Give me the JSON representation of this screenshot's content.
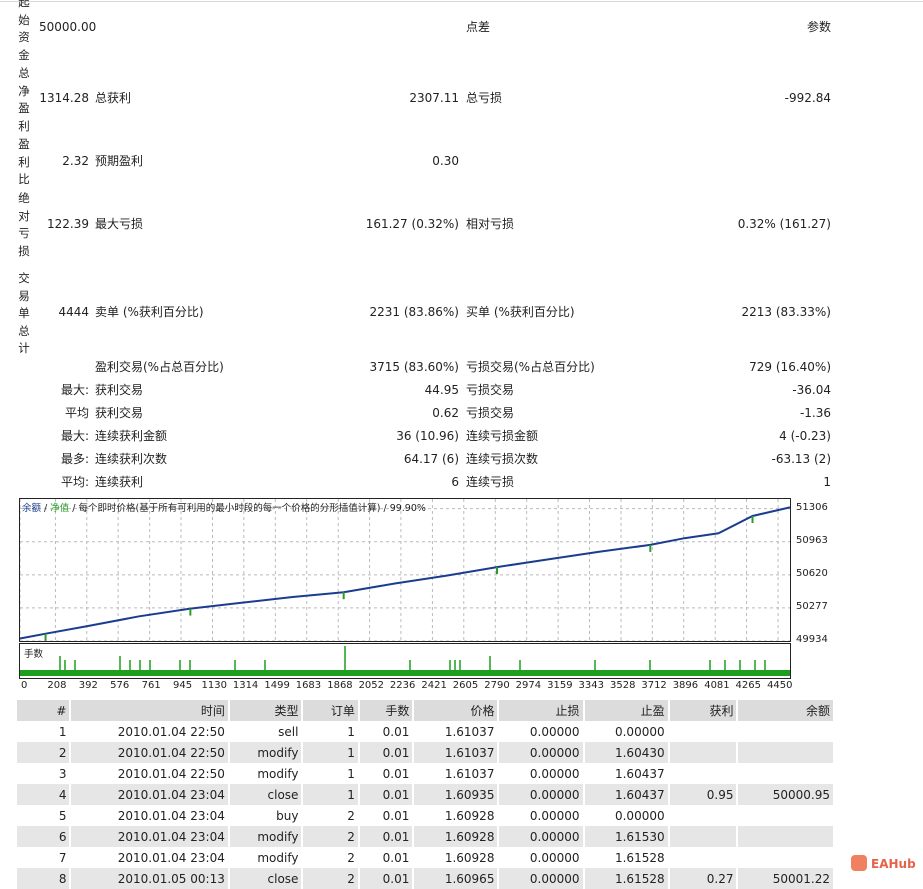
{
  "summary": {
    "initial_deposit_label": "起始资金",
    "initial_deposit": "50000.00",
    "spread_label": "点差",
    "params_label": "参数",
    "net_profit_label": "总净盈利",
    "net_profit": "1314.28",
    "gross_profit_label": "总获利",
    "gross_profit": "2307.11",
    "gross_loss_label": "总亏损",
    "gross_loss": "-992.84",
    "profit_factor_label": "盈利比",
    "profit_factor": "2.32",
    "expected_payoff_label": "预期盈利",
    "expected_payoff": "0.30",
    "abs_drawdown_label": "绝对亏损",
    "abs_drawdown": "122.39",
    "max_drawdown_label": "最大亏损",
    "max_drawdown": "161.27 (0.32%)",
    "rel_drawdown_label": "相对亏损",
    "rel_drawdown": "0.32% (161.27)",
    "total_trades_label": "交易单总计",
    "total_trades": "4444",
    "short_label": "卖单 (%获利百分比)",
    "short_value": "2231 (83.86%)",
    "long_label": "买单 (%获利百分比)",
    "long_value": "2213 (83.33%)",
    "profit_trades_label": "盈利交易(%占总百分比)",
    "profit_trades": "3715 (83.60%)",
    "loss_trades_label": "亏损交易(%占总百分比)",
    "loss_trades": "729 (16.40%)",
    "largest_prefix": "最大:",
    "largest_profit_label": "获利交易",
    "largest_profit": "44.95",
    "largest_loss_label": "亏损交易",
    "largest_loss": "-36.04",
    "average_prefix": "平均",
    "average_profit_label": "获利交易",
    "average_profit": "0.62",
    "average_loss_label": "亏损交易",
    "average_loss": "-1.36",
    "max_prefix": "最大:",
    "max_consec_win_money_label": "连续获利金额",
    "max_consec_win_money": "36 (10.96)",
    "max_consec_loss_money_label": "连续亏损金额",
    "max_consec_loss_money": "4 (-0.23)",
    "most_prefix": "最多:",
    "most_consec_win_count_label": "连续获利次数",
    "most_consec_win_count": "64.17 (6)",
    "most_consec_loss_count_label": "连续亏损次数",
    "most_consec_loss_count": "-63.13 (2)",
    "avg_prefix": "平均:",
    "avg_consec_win_label": "连续获利",
    "avg_consec_win": "6",
    "avg_consec_loss_label": "连续亏损",
    "avg_consec_loss": "1"
  },
  "chart_data": {
    "type": "line",
    "legend_balance": "余额",
    "legend_equity": "净值",
    "legend_text": "每个即时价格(基于所有可利用的最小时段的每一个价格的分形插值计算)",
    "legend_quality": "99.90%",
    "volume_label": "手数",
    "yticks": [
      "51306",
      "50963",
      "50620",
      "50277",
      "49934"
    ],
    "xticks": [
      "0",
      "208",
      "392",
      "576",
      "761",
      "945",
      "1130",
      "1314",
      "1499",
      "1683",
      "1868",
      "2052",
      "2236",
      "2421",
      "2605",
      "2790",
      "2974",
      "3159",
      "3343",
      "3528",
      "3712",
      "3896",
      "4081",
      "4265",
      "4450"
    ],
    "ylim": [
      49934,
      51406
    ],
    "xlim": [
      0,
      4520
    ],
    "series": [
      {
        "name": "余额",
        "x": [
          0,
          150,
          400,
          700,
          1000,
          1300,
          1600,
          1900,
          2200,
          2500,
          2800,
          3100,
          3400,
          3700,
          3900,
          4100,
          4300,
          4520
        ],
        "values": [
          49960,
          50010,
          50090,
          50190,
          50270,
          50330,
          50390,
          50440,
          50530,
          50610,
          50700,
          50780,
          50860,
          50930,
          51000,
          51050,
          51230,
          51320
        ]
      }
    ],
    "colors": {
      "balance": "#1a3d8f",
      "equity": "#2a9a2a",
      "volume": "#1e9e1e"
    }
  },
  "table": {
    "headers": [
      "#",
      "时间",
      "类型",
      "订单",
      "手数",
      "价格",
      "止损",
      "止盈",
      "获利",
      "余额"
    ],
    "rows": [
      [
        "1",
        "2010.01.04 22:50",
        "sell",
        "1",
        "0.01",
        "1.61037",
        "0.00000",
        "0.00000",
        "",
        ""
      ],
      [
        "2",
        "2010.01.04 22:50",
        "modify",
        "1",
        "0.01",
        "1.61037",
        "0.00000",
        "1.60430",
        "",
        ""
      ],
      [
        "3",
        "2010.01.04 22:50",
        "modify",
        "1",
        "0.01",
        "1.61037",
        "0.00000",
        "1.60437",
        "",
        ""
      ],
      [
        "4",
        "2010.01.04 23:04",
        "close",
        "1",
        "0.01",
        "1.60935",
        "0.00000",
        "1.60437",
        "0.95",
        "50000.95"
      ],
      [
        "5",
        "2010.01.04 23:04",
        "buy",
        "2",
        "0.01",
        "1.60928",
        "0.00000",
        "0.00000",
        "",
        ""
      ],
      [
        "6",
        "2010.01.04 23:04",
        "modify",
        "2",
        "0.01",
        "1.60928",
        "0.00000",
        "1.61530",
        "",
        ""
      ],
      [
        "7",
        "2010.01.04 23:04",
        "modify",
        "2",
        "0.01",
        "1.60928",
        "0.00000",
        "1.61528",
        "",
        ""
      ],
      [
        "8",
        "2010.01.05 00:13",
        "close",
        "2",
        "0.01",
        "1.60965",
        "0.00000",
        "1.61528",
        "0.27",
        "50001.22"
      ]
    ]
  },
  "watermark": "EAHub"
}
